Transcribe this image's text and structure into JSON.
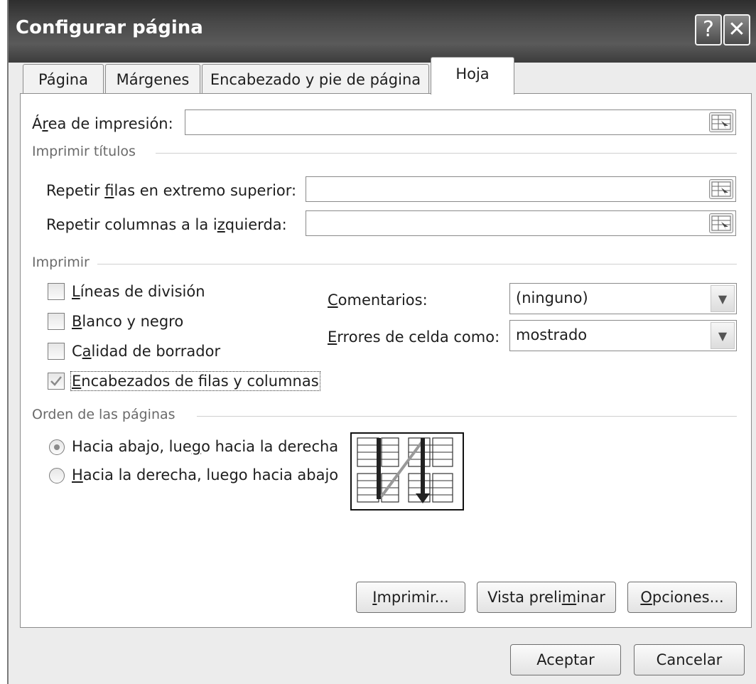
{
  "window": {
    "title": "Configurar página"
  },
  "titlebar_buttons": {
    "help": "?",
    "close": "✕"
  },
  "tabs": [
    {
      "label": "Página"
    },
    {
      "label": "Márgenes"
    },
    {
      "label": "Encabezado y pie de página"
    },
    {
      "label": "Hoja",
      "active": true
    }
  ],
  "sheet": {
    "print_area": {
      "label_pre": "Á",
      "label_u": "r",
      "label_post": "ea de impresión:",
      "value": ""
    },
    "print_titles": {
      "group": "Imprimir títulos",
      "rows": {
        "label_pre": "Repetir ",
        "label_u": "f",
        "label_post": "ilas en extremo superior:",
        "value": ""
      },
      "cols": {
        "label_pre": "Repetir columnas a la i",
        "label_u": "z",
        "label_post": "quierda:",
        "value": ""
      }
    },
    "print": {
      "group": "Imprimir",
      "gridlines": {
        "u": "L",
        "rest": "íneas de división",
        "checked": false
      },
      "black_white": {
        "u": "B",
        "rest": "lanco y negro",
        "checked": false
      },
      "draft": {
        "pre": "C",
        "u": "a",
        "rest": "lidad de borrador",
        "checked": false
      },
      "headings": {
        "u": "E",
        "rest": "ncabezados de filas y columnas",
        "checked": true
      },
      "comments": {
        "u": "C",
        "rest": "omentarios:",
        "value": "(ninguno)"
      },
      "cell_errors": {
        "u": "E",
        "rest": "rrores de celda como:",
        "value": "mostrado"
      }
    },
    "page_order": {
      "group": "Orden de las páginas",
      "down_over": {
        "pre": "Hacia abajo, lue",
        "u": "g",
        "rest": "o hacia la derecha",
        "selected": true
      },
      "over_down": {
        "u": "H",
        "rest": "acia la derecha, luego hacia abajo",
        "selected": false
      }
    }
  },
  "panel_buttons": {
    "print": {
      "u": "I",
      "rest": "mprimir..."
    },
    "preview": {
      "pre": "Vista preli",
      "u": "m",
      "rest": "inar"
    },
    "options": {
      "u": "O",
      "rest": "pciones..."
    }
  },
  "dialog_buttons": {
    "ok": "Aceptar",
    "cancel": "Cancelar"
  },
  "icons": {
    "close": "close-icon",
    "help": "help-icon",
    "collapse": "collapse-dialog-icon",
    "dropdown": "chevron-down-icon",
    "check": "checkmark-icon"
  }
}
